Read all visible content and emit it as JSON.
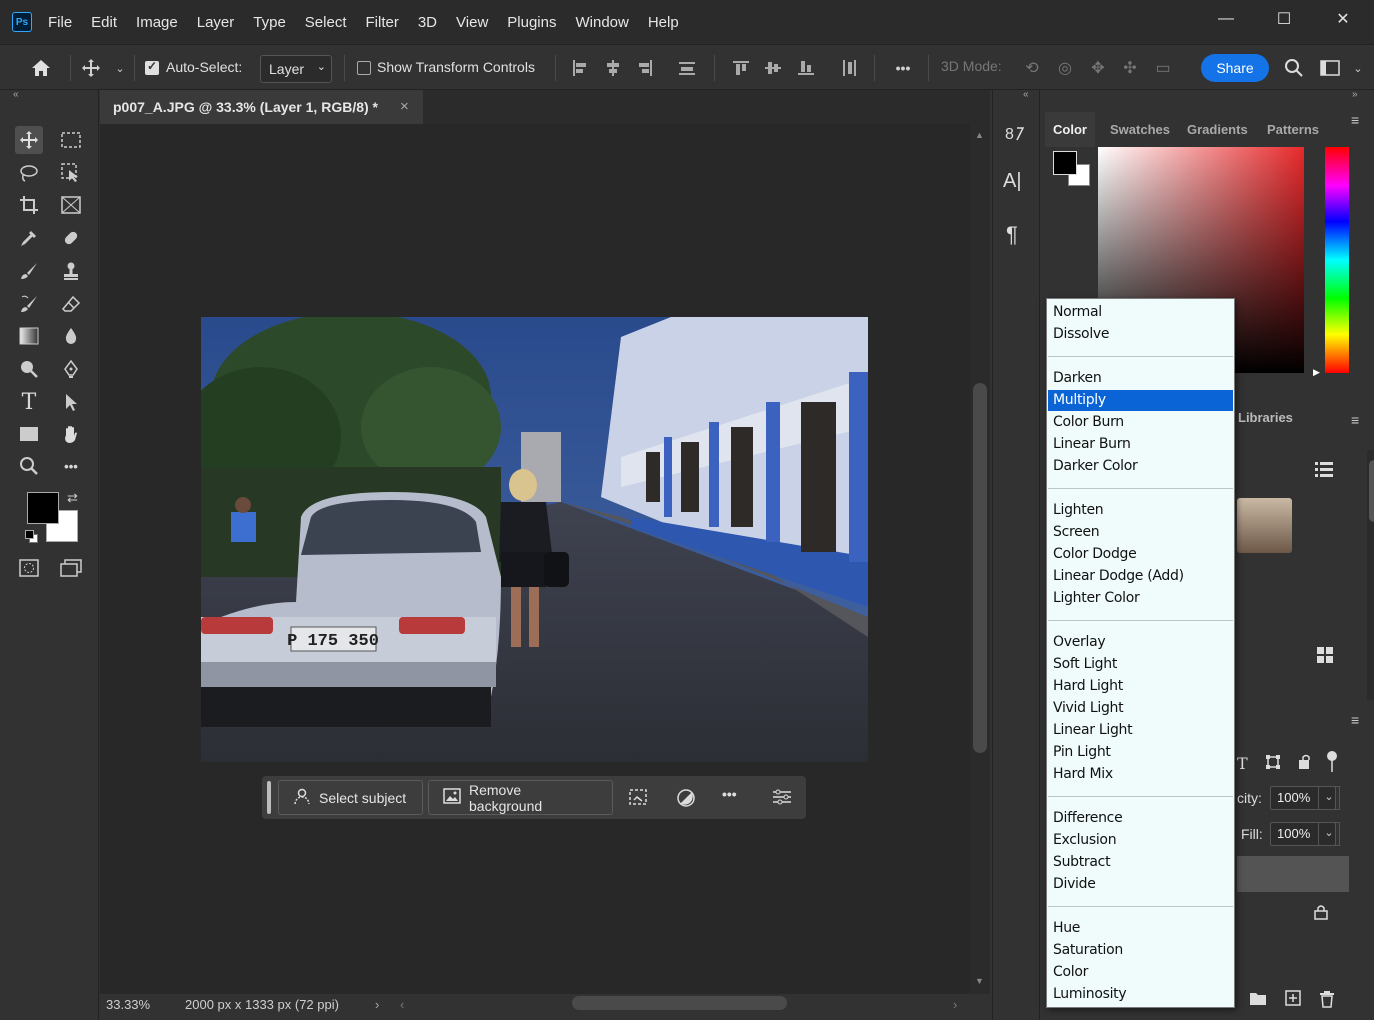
{
  "menubar": {
    "logo": "Ps",
    "items": [
      "File",
      "Edit",
      "Image",
      "Layer",
      "Type",
      "Select",
      "Filter",
      "3D",
      "View",
      "Plugins",
      "Window",
      "Help"
    ],
    "window_controls": [
      "—",
      "☐",
      "✕"
    ]
  },
  "options": {
    "auto_select_label": "Auto-Select:",
    "auto_select_checked": true,
    "auto_select_target": "Layer",
    "show_transform_label": "Show Transform Controls",
    "show_transform_checked": false,
    "more": "•••",
    "mode_3d_label": "3D Mode:",
    "share_label": "Share"
  },
  "document": {
    "tab_title": "p007_A.JPG @ 33.3% (Layer 1, RGB/8) *",
    "close": "×",
    "zoom": "33.33%",
    "dimensions": "2000 px x 1333 px (72 ppi)",
    "license_plate": "P 175 350"
  },
  "taskbar": {
    "select_subject": "Select subject",
    "remove_background": "Remove background",
    "more": "•••"
  },
  "right_panel": {
    "tabs": [
      "Color",
      "Swatches",
      "Gradients",
      "Patterns"
    ],
    "active_tab": "Color",
    "libraries_label": "Libraries",
    "opacity_label": "city:",
    "opacity_value": "100%",
    "fill_label": "Fill:",
    "fill_value": "100%"
  },
  "blend_modes": {
    "groups": [
      [
        "Normal",
        "Dissolve"
      ],
      [
        "Darken",
        "Multiply",
        "Color Burn",
        "Linear Burn",
        "Darker Color"
      ],
      [
        "Lighten",
        "Screen",
        "Color Dodge",
        "Linear Dodge (Add)",
        "Lighter Color"
      ],
      [
        "Overlay",
        "Soft Light",
        "Hard Light",
        "Vivid Light",
        "Linear Light",
        "Pin Light",
        "Hard Mix"
      ],
      [
        "Difference",
        "Exclusion",
        "Subtract",
        "Divide"
      ],
      [
        "Hue",
        "Saturation",
        "Color",
        "Luminosity"
      ]
    ],
    "selected": "Multiply"
  },
  "colors": {
    "foreground": "#000000",
    "background": "#ffffff",
    "accent": "#1473e6",
    "selection": "#0a64d6"
  }
}
